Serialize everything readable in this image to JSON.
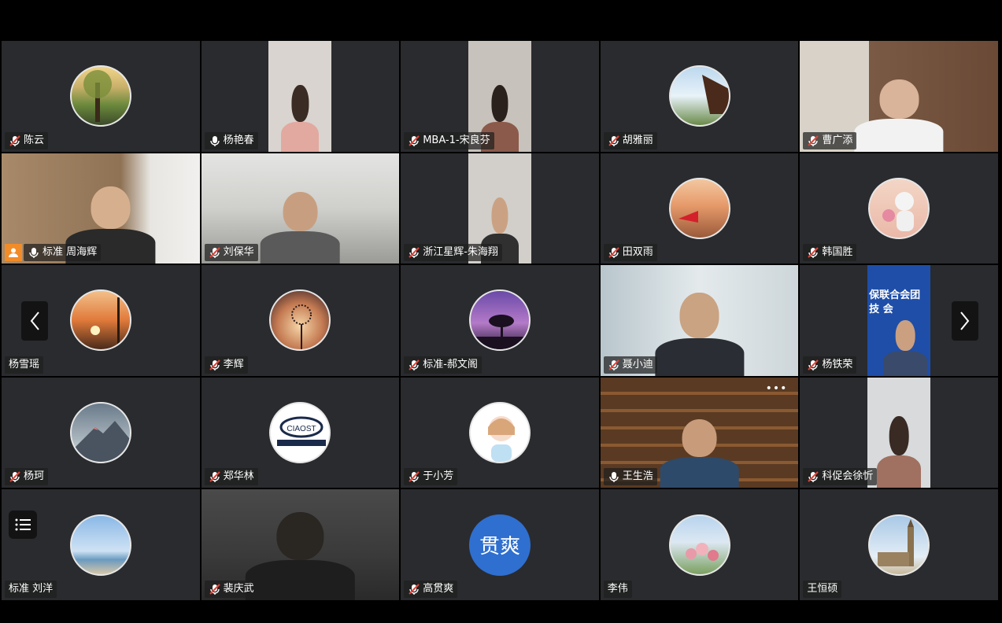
{
  "participants": [
    {
      "name": "陈云",
      "mic": "muted",
      "type": "avatar",
      "avatar_icon": "tree-landscape-icon"
    },
    {
      "name": "杨艳春",
      "mic": "on",
      "type": "video"
    },
    {
      "name": "MBA-1-宋良芬",
      "mic": "muted",
      "type": "video"
    },
    {
      "name": "胡雅丽",
      "mic": "muted",
      "type": "avatar",
      "avatar_icon": "temple-roof-icon"
    },
    {
      "name": "曹广添",
      "mic": "muted",
      "type": "video"
    },
    {
      "name": "标准 周海辉",
      "mic": "on",
      "type": "video",
      "host": true,
      "active": true
    },
    {
      "name": "刘保华",
      "mic": "muted",
      "type": "video"
    },
    {
      "name": "浙江星辉-朱海翔",
      "mic": "muted",
      "type": "video"
    },
    {
      "name": "田双雨",
      "mic": "muted",
      "type": "avatar",
      "avatar_icon": "sunset-flag-icon"
    },
    {
      "name": "韩国胜",
      "mic": "muted",
      "type": "avatar",
      "avatar_icon": "astronaut-icon"
    },
    {
      "name": "杨雪瑶",
      "mic": "none",
      "type": "avatar",
      "avatar_icon": "sunset-pole-icon"
    },
    {
      "name": "李辉",
      "mic": "muted",
      "type": "avatar",
      "avatar_icon": "dandelion-icon"
    },
    {
      "name": "标准-郝文阁",
      "mic": "muted",
      "type": "avatar",
      "avatar_icon": "purple-tree-icon"
    },
    {
      "name": "聂小迪",
      "mic": "muted",
      "type": "video"
    },
    {
      "name": "杨铁荣",
      "mic": "muted",
      "type": "video",
      "screen_text": [
        "保联合会团",
        "技 会"
      ]
    },
    {
      "name": "杨珂",
      "mic": "muted",
      "type": "avatar",
      "avatar_icon": "mountain-peak-icon"
    },
    {
      "name": "郑华林",
      "mic": "muted",
      "type": "avatar",
      "avatar_icon": "ciaost-logo-icon",
      "logo_text": "CIAOST"
    },
    {
      "name": "于小芳",
      "mic": "muted",
      "type": "avatar",
      "avatar_icon": "cartoon-girl-icon"
    },
    {
      "name": "王生浩",
      "mic": "on",
      "type": "video",
      "more": "•••"
    },
    {
      "name": "科促会徐忻",
      "mic": "muted",
      "type": "video"
    },
    {
      "name": "标准 刘洋",
      "mic": "none",
      "type": "avatar",
      "avatar_icon": "beach-sky-icon"
    },
    {
      "name": "裴庆武",
      "mic": "muted",
      "type": "video"
    },
    {
      "name": "高贯爽",
      "mic": "muted",
      "type": "text-avatar",
      "avatar_text": "贯爽"
    },
    {
      "name": "李伟",
      "mic": "none",
      "type": "avatar",
      "avatar_icon": "roses-icon"
    },
    {
      "name": "王恒硕",
      "mic": "none",
      "type": "avatar",
      "avatar_icon": "big-ben-icon"
    }
  ],
  "colors": {
    "tile_bg": "#2a2b2e",
    "active_border": "#1fb55a",
    "muted_mic": "#e0453a",
    "host_badge": "#f28c28",
    "text_avatar_bg": "#2f6fcf"
  }
}
